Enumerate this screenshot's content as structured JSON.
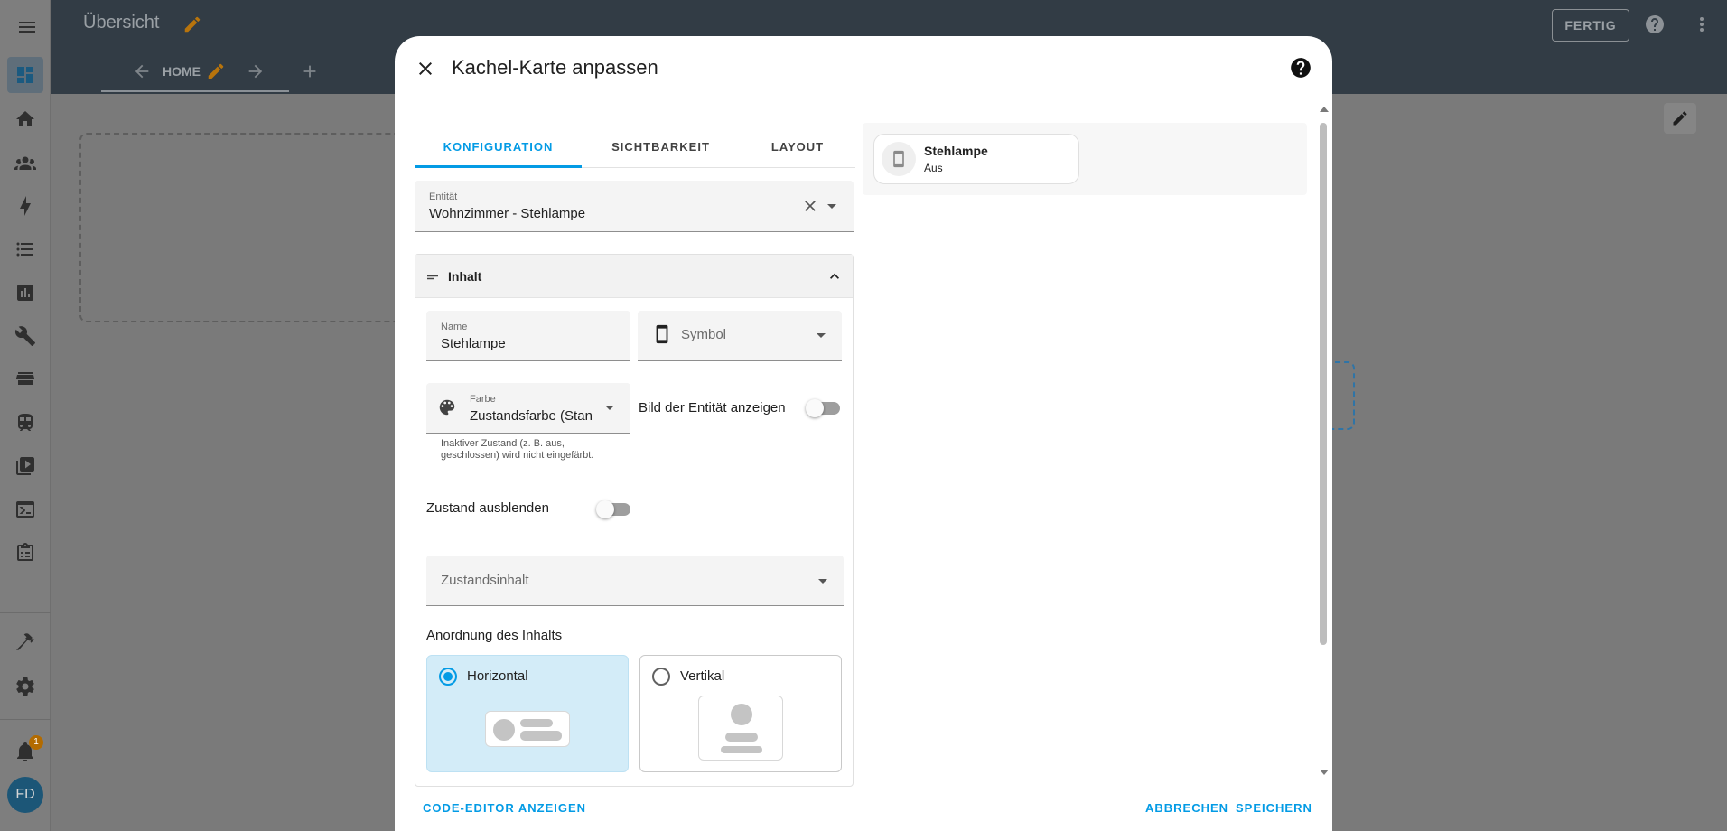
{
  "app": {
    "title": "Übersicht",
    "view_tab": "HOME",
    "done_label": "FERTIG",
    "notification_count": "1",
    "user_initials": "FD"
  },
  "sidebar": {
    "items": [
      {
        "name": "overview",
        "icon": "dashboard-icon"
      },
      {
        "name": "home",
        "icon": "home-icon"
      },
      {
        "name": "people",
        "icon": "account-group-icon"
      },
      {
        "name": "energy",
        "icon": "lightning-icon"
      },
      {
        "name": "logbook",
        "icon": "list-icon"
      },
      {
        "name": "history",
        "icon": "chart-box-icon"
      },
      {
        "name": "settings-tools",
        "icon": "wrench-icon"
      },
      {
        "name": "hacs",
        "icon": "store-icon"
      },
      {
        "name": "transport",
        "icon": "train-icon"
      },
      {
        "name": "media",
        "icon": "play-box-icon"
      },
      {
        "name": "terminal",
        "icon": "console-icon"
      },
      {
        "name": "todo",
        "icon": "clipboard-list-icon"
      },
      {
        "name": "developer-tools",
        "icon": "hammer-icon"
      },
      {
        "name": "settings",
        "icon": "cog-icon"
      },
      {
        "name": "notifications",
        "icon": "bell-icon"
      }
    ]
  },
  "dialog": {
    "title": "Kachel-Karte anpassen",
    "tabs": [
      "KONFIGURATION",
      "SICHTBARKEIT",
      "LAYOUT"
    ],
    "active_tab": "KONFIGURATION",
    "entity": {
      "label": "Entität",
      "value": "Wohnzimmer - Stehlampe"
    },
    "content_section": {
      "title": "Inhalt",
      "name": {
        "label": "Name",
        "value": "Stehlampe"
      },
      "symbol": {
        "placeholder": "Symbol"
      },
      "color": {
        "label": "Farbe",
        "value": "Zustandsfarbe (Stan",
        "helper": "Inaktiver Zustand (z. B. aus, geschlossen) wird nicht eingefärbt."
      },
      "show_entity_picture": {
        "label": "Bild der Entität anzeigen",
        "on": false
      },
      "hide_state": {
        "label": "Zustand ausblenden",
        "on": false
      },
      "state_content": {
        "placeholder": "Zustandsinhalt"
      },
      "arrangement": {
        "label": "Anordnung des Inhalts",
        "options": [
          {
            "label": "Horizontal",
            "selected": true
          },
          {
            "label": "Vertikal",
            "selected": false
          }
        ]
      }
    },
    "preview": {
      "name": "Stehlampe",
      "state": "Aus",
      "icon": "cellphone-icon"
    },
    "footer": {
      "code_editor": "CODE-EDITOR ANZEIGEN",
      "cancel": "ABBRECHEN",
      "save": "SPEICHERN"
    }
  },
  "colors": {
    "accent": "#039be5",
    "header_bg": "#323c45",
    "edit_orange": "#b8740c"
  }
}
